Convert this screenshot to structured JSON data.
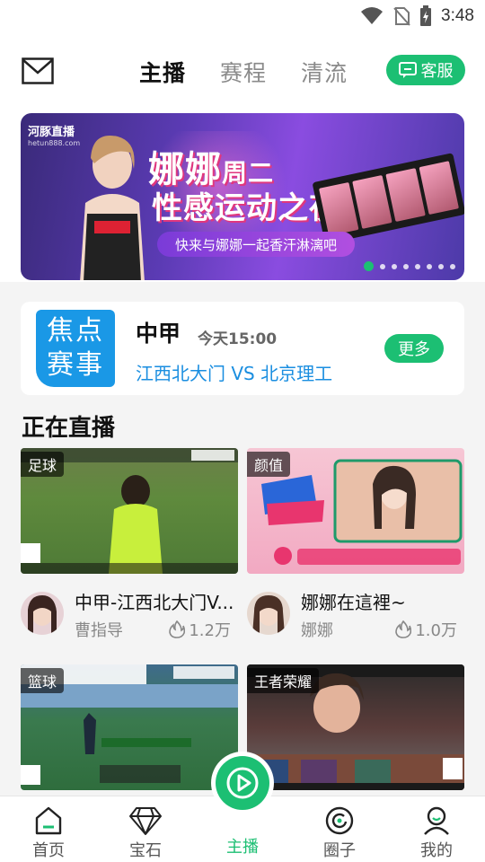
{
  "status_bar": {
    "time": "3:48"
  },
  "header": {
    "tabs": [
      {
        "label": "主播",
        "active": true
      },
      {
        "label": "赛程",
        "active": false
      },
      {
        "label": "清流",
        "active": false
      }
    ],
    "service_label": "客服"
  },
  "banner": {
    "logo": "河豚直播",
    "logo_sub": "hetun888.com",
    "title_name": "娜娜",
    "title_day": "周二",
    "title_line2": "性感运动之夜",
    "subtitle": "快来与娜娜一起香汗淋漓吧",
    "slide_count": 8,
    "active_slide": 1
  },
  "focus": {
    "badge": "焦点赛事",
    "badge_line1": "焦点",
    "badge_line2": "赛事",
    "league": "中甲",
    "time": "今天15:00",
    "match": "江西北大门 VS 北京理工",
    "more_label": "更多"
  },
  "live": {
    "section_title": "正在直播",
    "cards": [
      {
        "tag": "足球",
        "title": "中甲-江西北大门V...",
        "streamer": "曹指导",
        "viewers": "1.2万"
      },
      {
        "tag": "颜值",
        "title": "娜娜在這裡~",
        "streamer": "娜娜",
        "viewers": "1.0万"
      },
      {
        "tag": "篮球"
      },
      {
        "tag": "王者荣耀"
      }
    ]
  },
  "bottom_nav": [
    {
      "label": "首页",
      "icon": "home-icon"
    },
    {
      "label": "宝石",
      "icon": "gem-icon"
    },
    {
      "label": "主播",
      "icon": "play-icon",
      "active": true
    },
    {
      "label": "圈子",
      "icon": "circle-icon"
    },
    {
      "label": "我的",
      "icon": "profile-icon"
    }
  ],
  "colors": {
    "accent": "#1cbf73",
    "link": "#1a8ee0",
    "badge_blue": "#1a98e6"
  }
}
